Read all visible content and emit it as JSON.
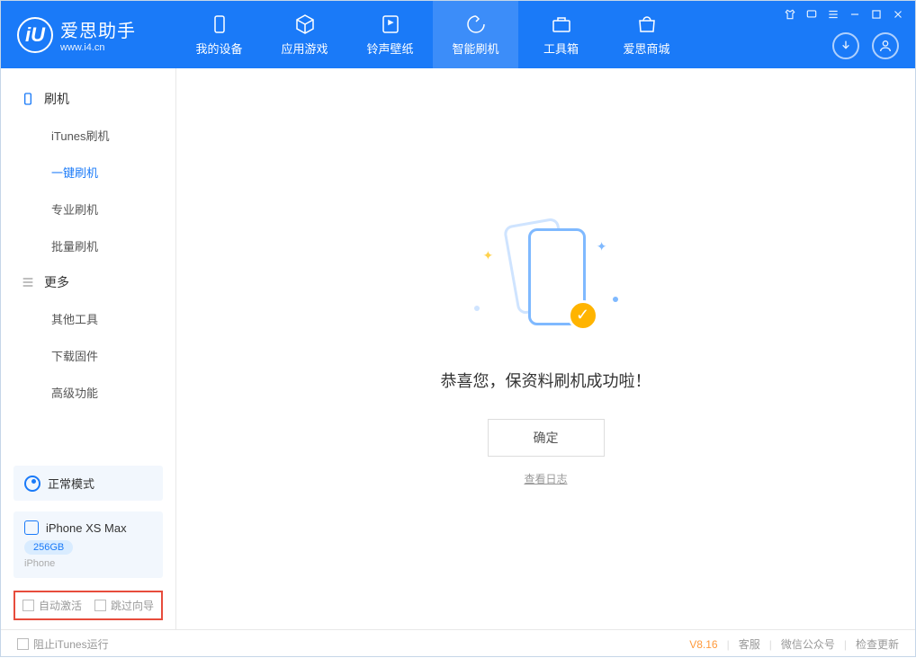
{
  "app": {
    "title": "爱思助手",
    "url": "www.i4.cn",
    "logo_letter": "iU"
  },
  "nav": [
    {
      "label": "我的设备"
    },
    {
      "label": "应用游戏"
    },
    {
      "label": "铃声壁纸"
    },
    {
      "label": "智能刷机"
    },
    {
      "label": "工具箱"
    },
    {
      "label": "爱思商城"
    }
  ],
  "sidebar": {
    "group1_title": "刷机",
    "group1_items": [
      "iTunes刷机",
      "一键刷机",
      "专业刷机",
      "批量刷机"
    ],
    "group2_title": "更多",
    "group2_items": [
      "其他工具",
      "下载固件",
      "高级功能"
    ]
  },
  "mode": {
    "label": "正常模式"
  },
  "device": {
    "name": "iPhone XS Max",
    "storage": "256GB",
    "type": "iPhone"
  },
  "checkboxes": {
    "auto_activate": "自动激活",
    "skip_wizard": "跳过向导"
  },
  "main": {
    "success_msg": "恭喜您，保资料刷机成功啦！",
    "ok_button": "确定",
    "view_log": "查看日志"
  },
  "status": {
    "block_itunes": "阻止iTunes运行",
    "version": "V8.16",
    "service": "客服",
    "wechat": "微信公众号",
    "check_update": "检查更新"
  }
}
